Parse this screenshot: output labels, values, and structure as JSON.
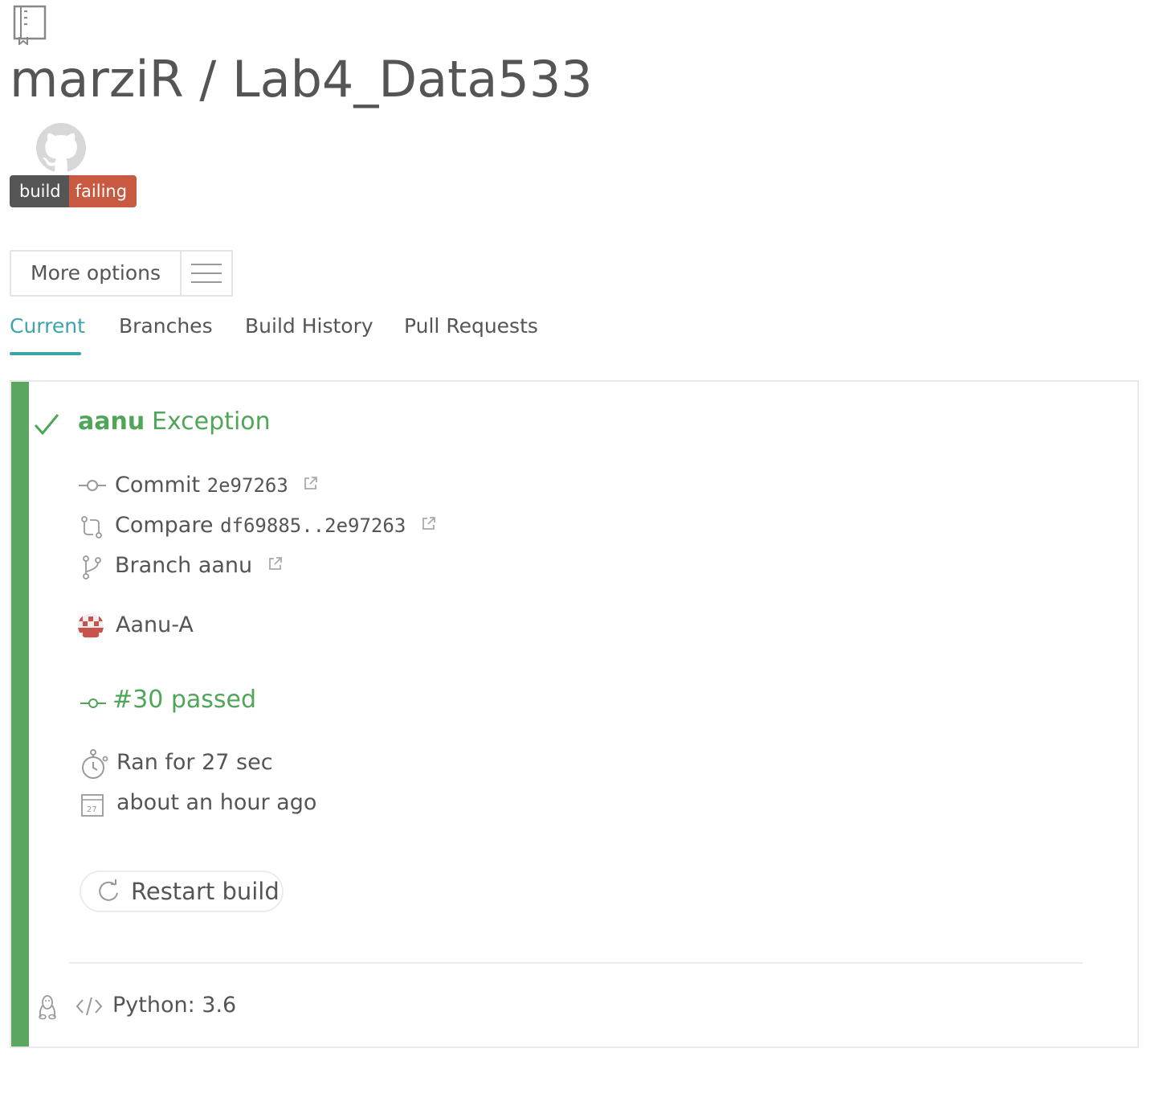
{
  "repo": {
    "owner": "marziR",
    "separator": "/",
    "name": "Lab4_Data533",
    "title": "marziR / Lab4_Data533",
    "icon": "repo-book-icon",
    "github_icon": "github-octocat-icon"
  },
  "badge": {
    "left_label": "build",
    "right_label": "failing",
    "left_color": "#555555",
    "right_color": "#c75a41"
  },
  "more_options": {
    "label": "More options",
    "icon": "hamburger-menu-icon"
  },
  "tabs": [
    {
      "label": "Current",
      "active": true
    },
    {
      "label": "Branches",
      "active": false
    },
    {
      "label": "Build History",
      "active": false
    },
    {
      "label": "Pull Requests",
      "active": false
    }
  ],
  "build": {
    "status_icon": "check-icon",
    "branch": "aanu",
    "message": "Exception",
    "commit_label": "Commit",
    "commit_hash": "2e97263",
    "compare_label": "Compare",
    "compare_range": "df69885..2e97263",
    "branch_label": "Branch",
    "branch_value": "aanu",
    "author": "Aanu-A",
    "status_text": "#30 passed",
    "duration": "Ran for 27 sec",
    "finished": "about an hour ago",
    "restart_label": "Restart build",
    "language": "Python: 3.6",
    "accent_color": "#5ba661",
    "tab_accent_color": "#3fa4a8"
  }
}
